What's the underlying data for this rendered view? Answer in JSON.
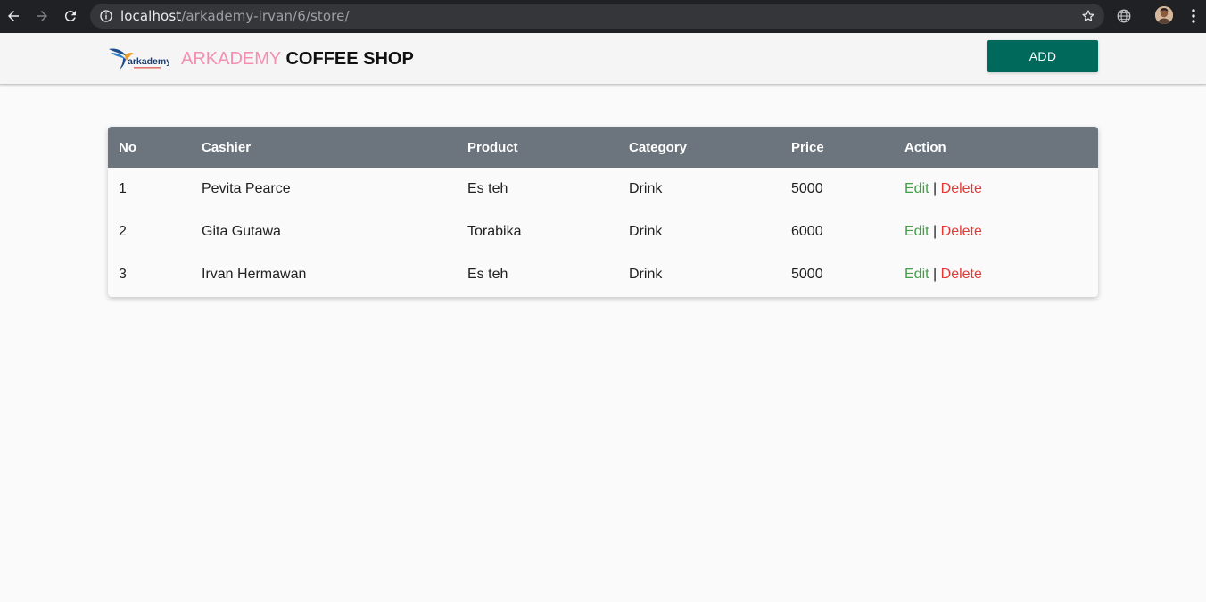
{
  "browser": {
    "url_host": "localhost",
    "url_path": "/arkademy-irvan/6/store/"
  },
  "header": {
    "logo_text": "arkademy",
    "brand_part1": "ARKADEMY",
    "brand_part2": "COFFEE SHOP",
    "add_label": "ADD"
  },
  "table": {
    "columns": [
      "No",
      "Cashier",
      "Product",
      "Category",
      "Price",
      "Action"
    ],
    "rows": [
      {
        "no": "1",
        "cashier": "Pevita Pearce",
        "product": "Es teh",
        "category": "Drink",
        "price": "5000"
      },
      {
        "no": "2",
        "cashier": "Gita Gutawa",
        "product": "Torabika",
        "category": "Drink",
        "price": "6000"
      },
      {
        "no": "3",
        "cashier": "Irvan Hermawan",
        "product": "Es teh",
        "category": "Drink",
        "price": "5000"
      }
    ],
    "edit_label": "Edit",
    "separator": "|",
    "delete_label": "Delete"
  },
  "colors": {
    "header_bg": "#6c757d",
    "add_button": "#00695c",
    "brand_pink": "#f48fb1",
    "edit_green": "#43a047",
    "delete_red": "#e53935"
  }
}
